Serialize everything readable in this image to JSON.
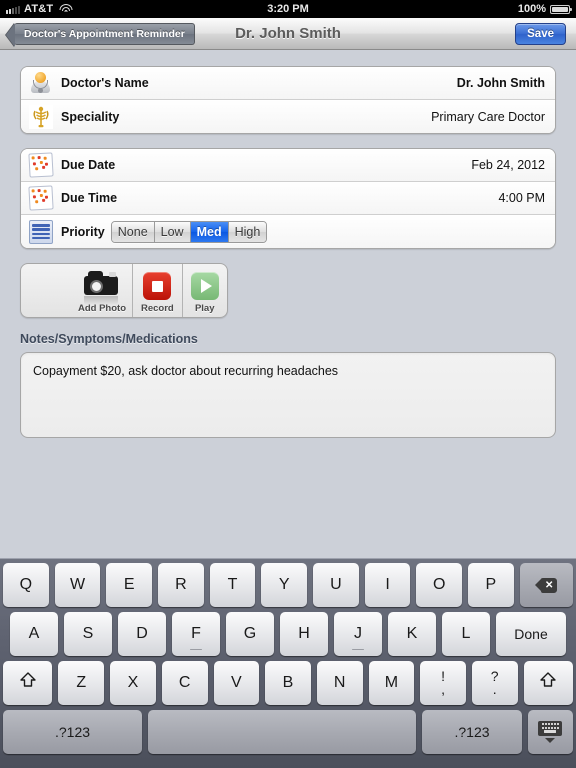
{
  "status_bar": {
    "signal_icon": "signal-bars-icon",
    "carrier": "AT&T",
    "wifi_icon": "wifi-icon",
    "time": "3:20 PM",
    "battery_percent": "100%",
    "battery_icon": "battery-full-icon"
  },
  "nav_bar": {
    "back_label": "Doctor's Appointment Reminder",
    "title": "Dr. John Smith",
    "save_label": "Save"
  },
  "form": {
    "section_one": [
      {
        "icon": "doctor-avatar-icon",
        "label": "Doctor's Name",
        "value": "Dr. John Smith",
        "bold": true
      },
      {
        "icon": "caduceus-icon",
        "label": "Speciality",
        "value": "Primary Care Doctor",
        "bold": false
      }
    ],
    "section_two": {
      "due_date": {
        "icon": "calendar-icon",
        "label": "Due Date",
        "value": "Feb 24, 2012"
      },
      "due_time": {
        "icon": "calendar-icon",
        "label": "Due Time",
        "value": "4:00 PM"
      },
      "priority": {
        "icon": "priority-stripes-icon",
        "label": "Priority",
        "options": [
          "None",
          "Low",
          "Med",
          "High"
        ],
        "selected": "Med",
        "selected_color": "#1463ec"
      }
    }
  },
  "media_bar": {
    "add_photo": {
      "icon": "camera-icon",
      "label": "Add Photo"
    },
    "record": {
      "icon": "record-stop-icon",
      "label": "Record",
      "color": "#bb1207"
    },
    "play": {
      "icon": "play-icon",
      "label": "Play",
      "color": "#77b874"
    }
  },
  "notes": {
    "label": "Notes/Symptoms/Medications",
    "value": "Copayment $20, ask doctor about recurring headaches"
  },
  "keyboard": {
    "row1": [
      "Q",
      "W",
      "E",
      "R",
      "T",
      "Y",
      "U",
      "I",
      "O",
      "P"
    ],
    "delete_key": "delete-key",
    "row2": [
      "A",
      "S",
      "D",
      "F",
      "G",
      "H",
      "J",
      "K",
      "L"
    ],
    "done_label": "Done",
    "row3": [
      "Z",
      "X",
      "C",
      "V",
      "B",
      "N",
      "M"
    ],
    "shift_icon": "shift-icon",
    "punct1": {
      "up": "!",
      "lo": ","
    },
    "punct2": {
      "up": "?",
      "lo": "."
    },
    "numeric_left": ".?123",
    "numeric_right": ".?123",
    "space_key": "space-key",
    "hide_keyboard_icon": "hide-keyboard-icon"
  },
  "colors": {
    "background": "#ccd0d8",
    "accent_blue": "#1463ec",
    "keyboard_bg": "#5e6270"
  }
}
